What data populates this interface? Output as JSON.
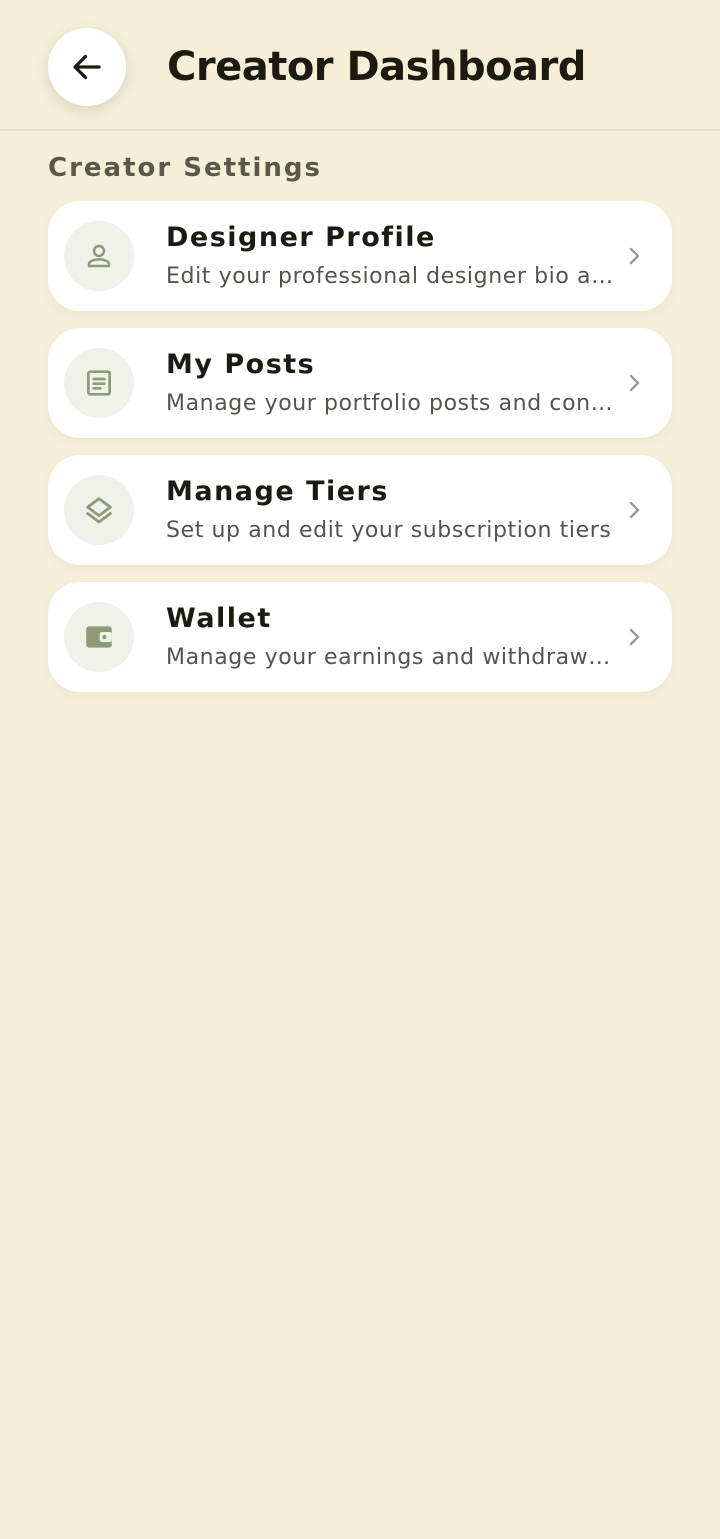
{
  "header": {
    "title": "Creator Dashboard",
    "back_icon": "arrow-left-icon"
  },
  "section": {
    "title": "Creator Settings"
  },
  "menu": {
    "items": [
      {
        "title": "Designer Profile",
        "description": "Edit your professional designer bio and details",
        "icon": "person-icon"
      },
      {
        "title": "My Posts",
        "description": "Manage your portfolio posts and content",
        "icon": "document-icon"
      },
      {
        "title": "Manage Tiers",
        "description": "Set up and edit your subscription tiers",
        "icon": "layers-icon"
      },
      {
        "title": "Wallet",
        "description": "Manage your earnings and withdrawals",
        "icon": "wallet-icon"
      }
    ]
  },
  "colors": {
    "background": "#f5efd8",
    "card": "#ffffff",
    "icon_accent": "#8e9a75",
    "icon_circle": "#f0f2ea",
    "chevron": "#9a9a9a"
  }
}
